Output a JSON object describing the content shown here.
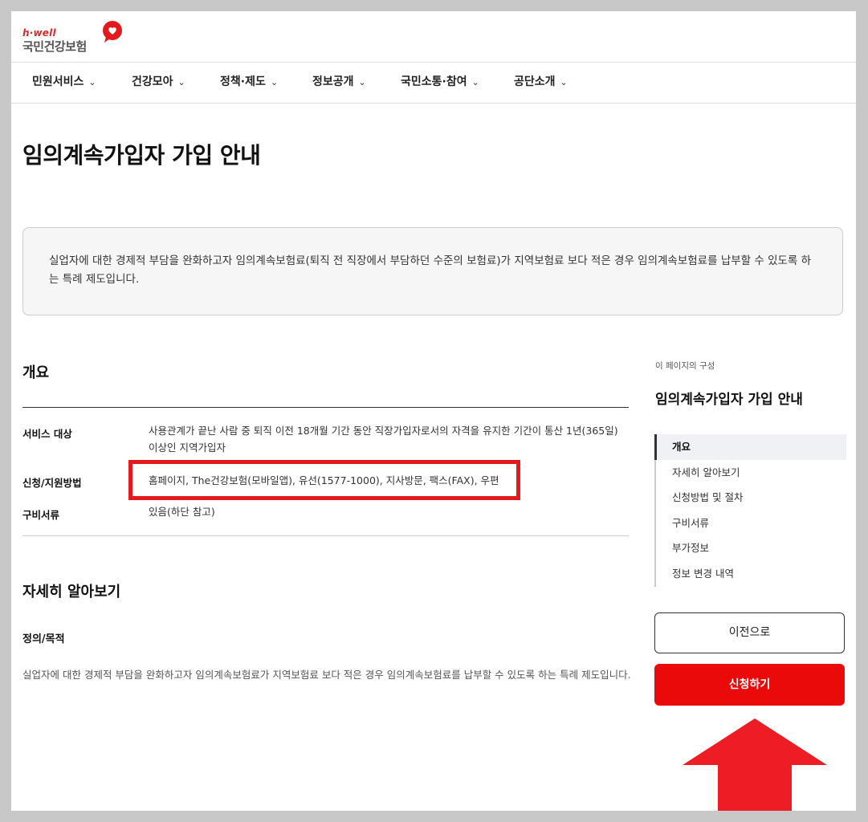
{
  "header": {
    "brand": "h·well",
    "org_name": "국민건강보험"
  },
  "nav": {
    "items": [
      {
        "label": "민원서비스"
      },
      {
        "label": "건강모아"
      },
      {
        "label": "정책·제도"
      },
      {
        "label": "정보공개"
      },
      {
        "label": "국민소통·참여"
      },
      {
        "label": "공단소개"
      }
    ]
  },
  "page": {
    "title": "임의계속가입자 가입 안내",
    "intro": "실업자에 대한 경제적 부담을 완화하고자 임의계속보험료(퇴직 전 직장에서 부담하던 수준의 보험료)가 지역보험료 보다 적은 경우 임의계속보험료를 납부할 수 있도록 하는 특례 제도입니다."
  },
  "overview": {
    "title": "개요",
    "rows": [
      {
        "label": "서비스 대상",
        "value": "사용관계가 끝난 사람 중 퇴직 이전 18개월 기간 동안 직장가입자로서의 자격을 유지한 기간이 통산 1년(365일) 이상인 지역가입자"
      },
      {
        "label": "신청/지원방법",
        "value": "홈페이지, The건강보험(모바일앱), 유선(1577-1000), 지사방문, 팩스(FAX), 우편"
      },
      {
        "label": "구비서류",
        "value": "있음(하단 참고)"
      }
    ]
  },
  "details": {
    "title": "자세히 알아보기",
    "sub_label": "정의/목적",
    "text": "실업자에 대한 경제적 부담을 완화하고자 임의계속보험료가 지역보험료 보다 적은 경우 임의계속보험료를 납부할 수 있도록 하는 특례 제도입니다."
  },
  "sidebar": {
    "caption": "이 페이지의 구성",
    "title": "임의계속가입자 가입 안내",
    "toc": [
      {
        "label": "개요"
      },
      {
        "label": "자세히 알아보기"
      },
      {
        "label": "신청방법 및 절차"
      },
      {
        "label": "구비서류"
      },
      {
        "label": "부가정보"
      },
      {
        "label": "정보 변경 내역"
      }
    ],
    "prev_button": "이전으로",
    "apply_button": "신청하기"
  },
  "colors": {
    "accent_red": "#ea0a0a",
    "highlight_red": "#e3191e",
    "arrow_red": "#ee1c25"
  }
}
